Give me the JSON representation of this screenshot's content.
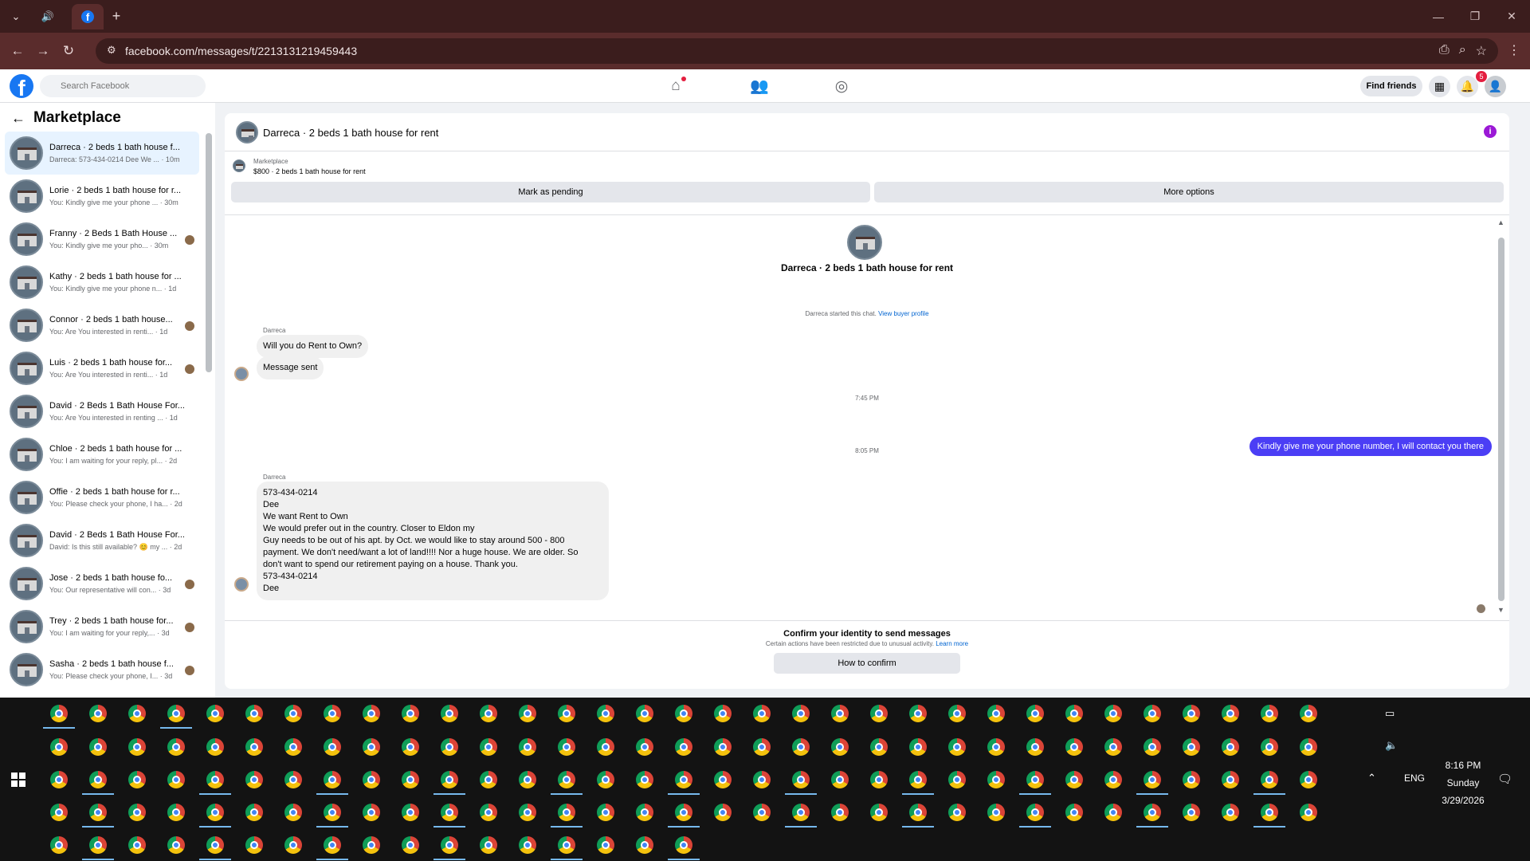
{
  "browser": {
    "url": "facebook.com/messages/t/2213131219459443",
    "new_tab": "+"
  },
  "fb": {
    "search_placeholder": "Search Facebook",
    "find_friends": "Find friends",
    "notification_count": "5",
    "brand_color": "#1877f2"
  },
  "sidebar": {
    "title": "Marketplace",
    "conversations": [
      {
        "title": "Darreca · 2 beds 1 bath house f...",
        "preview": "Darreca: 573-434-0214 Dee We ...",
        "time": "· 10m",
        "active": true
      },
      {
        "title": "Lorie · 2 beds 1 bath house for r...",
        "preview": "You: Kindly give me your phone ...",
        "time": "· 30m"
      },
      {
        "title": "Franny · 2 Beds 1 Bath House ...",
        "preview": "You: Kindly give me your pho...",
        "time": "· 30m"
      },
      {
        "title": "Kathy · 2 beds 1 bath house for ...",
        "preview": "You: Kindly give me your phone n...",
        "time": "· 1d"
      },
      {
        "title": "Connor · 2 beds 1 bath house...",
        "preview": "You: Are You interested in renti...",
        "time": "· 1d"
      },
      {
        "title": "Luis · 2 beds 1 bath house for...",
        "preview": "You: Are You interested in renti...",
        "time": "· 1d"
      },
      {
        "title": "David · 2 Beds 1 Bath House For...",
        "preview": "You: Are You interested in renting ...",
        "time": "· 1d"
      },
      {
        "title": "Chloe · 2 beds 1 bath house for ...",
        "preview": "You: I am waiting for your reply, pl...",
        "time": "· 2d"
      },
      {
        "title": "Offie · 2 beds 1 bath house for r...",
        "preview": "You: Please check your phone, I ha...",
        "time": "· 2d"
      },
      {
        "title": "David · 2 Beds 1 Bath House For...",
        "preview": "David: Is this still available? 😊 my ...",
        "time": "· 2d"
      },
      {
        "title": "Jose · 2 beds 1 bath house fo...",
        "preview": "You: Our representative will con...",
        "time": "· 3d"
      },
      {
        "title": "Trey · 2 beds 1 bath house for...",
        "preview": "You: I am waiting for your reply,...",
        "time": "· 3d"
      },
      {
        "title": "Sasha · 2 beds 1 bath house f...",
        "preview": "You: Please check your phone, I...",
        "time": "· 3d"
      }
    ]
  },
  "thread": {
    "title": "Darreca · 2 beds 1 bath house for rent",
    "listing_label": "Marketplace",
    "listing_price": "$800 · 2 beds 1 bath house for rent",
    "mark_pending": "Mark as pending",
    "more_options": "More options",
    "started_text": "Darreca started this chat.",
    "buyer_link": "View buyer profile",
    "sender_name": "Darreca",
    "msg1": "Will you do Rent to Own?",
    "msg2": "Message sent",
    "time1": "7:45 PM",
    "outgoing": "Kindly give me your phone number, I will contact you there",
    "time2": "8:05 PM",
    "long_message_lines": [
      "573-434-0214",
      "Dee",
      "We want Rent to Own",
      "We would prefer out in the country. Closer to Eldon  my",
      "Guy needs to be out of his apt. by Oct. we would like to stay around 500 - 800",
      "payment. We don't need/want a lot of land!!!! Nor a huge house. We are older. So",
      "don't want to spend our retirement paying on a house. Thank you.",
      "573-434-0214",
      "Dee"
    ],
    "outgoing_color": "#4b3ef5"
  },
  "footer": {
    "title": "Confirm your identity to send messages",
    "sub": "Certain actions have been restricted due to unusual activity.",
    "link": "Learn more",
    "button": "How to confirm"
  },
  "taskbar": {
    "time": "8:16 PM",
    "day": "Sunday",
    "date": "3/29/2026",
    "lang": "ENG"
  }
}
